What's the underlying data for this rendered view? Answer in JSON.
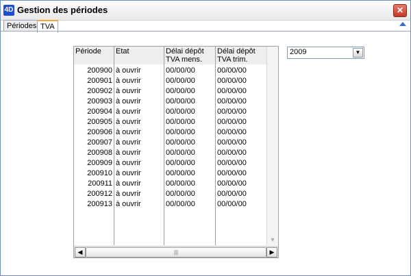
{
  "window": {
    "title": "Gestion des périodes",
    "app_icon_text": "4D",
    "close_glyph": "✕"
  },
  "tabs": [
    {
      "label": "Périodes"
    },
    {
      "label": "TVA"
    }
  ],
  "grid": {
    "columns": [
      "Période",
      "Etat",
      "Délai dépôt TVA mens.",
      "Délai dépôt TVA trim."
    ],
    "rows": [
      [
        "200900",
        "à ouvrir",
        "00/00/00",
        "00/00/00"
      ],
      [
        "200901",
        "à ouvrir",
        "00/00/00",
        "00/00/00"
      ],
      [
        "200902",
        "à ouvrir",
        "00/00/00",
        "00/00/00"
      ],
      [
        "200903",
        "à ouvrir",
        "00/00/00",
        "00/00/00"
      ],
      [
        "200904",
        "à ouvrir",
        "00/00/00",
        "00/00/00"
      ],
      [
        "200905",
        "à ouvrir",
        "00/00/00",
        "00/00/00"
      ],
      [
        "200906",
        "à ouvrir",
        "00/00/00",
        "00/00/00"
      ],
      [
        "200907",
        "à ouvrir",
        "00/00/00",
        "00/00/00"
      ],
      [
        "200908",
        "à ouvrir",
        "00/00/00",
        "00/00/00"
      ],
      [
        "200909",
        "à ouvrir",
        "00/00/00",
        "00/00/00"
      ],
      [
        "200910",
        "à ouvrir",
        "00/00/00",
        "00/00/00"
      ],
      [
        "200911",
        "à ouvrir",
        "00/00/00",
        "00/00/00"
      ],
      [
        "200912",
        "à ouvrir",
        "00/00/00",
        "00/00/00"
      ],
      [
        "200913",
        "à ouvrir",
        "00/00/00",
        "00/00/00"
      ]
    ]
  },
  "year_select": {
    "value": "2009"
  },
  "icons": {
    "app": "4d-logo-icon",
    "close": "close-icon",
    "collapse": "triangle-up-icon",
    "dropdown": "chevron-down-icon"
  },
  "colors": {
    "close_red": "#c0392b",
    "tab_accent": "#f0a830",
    "app_blue": "#1f4fcf"
  }
}
